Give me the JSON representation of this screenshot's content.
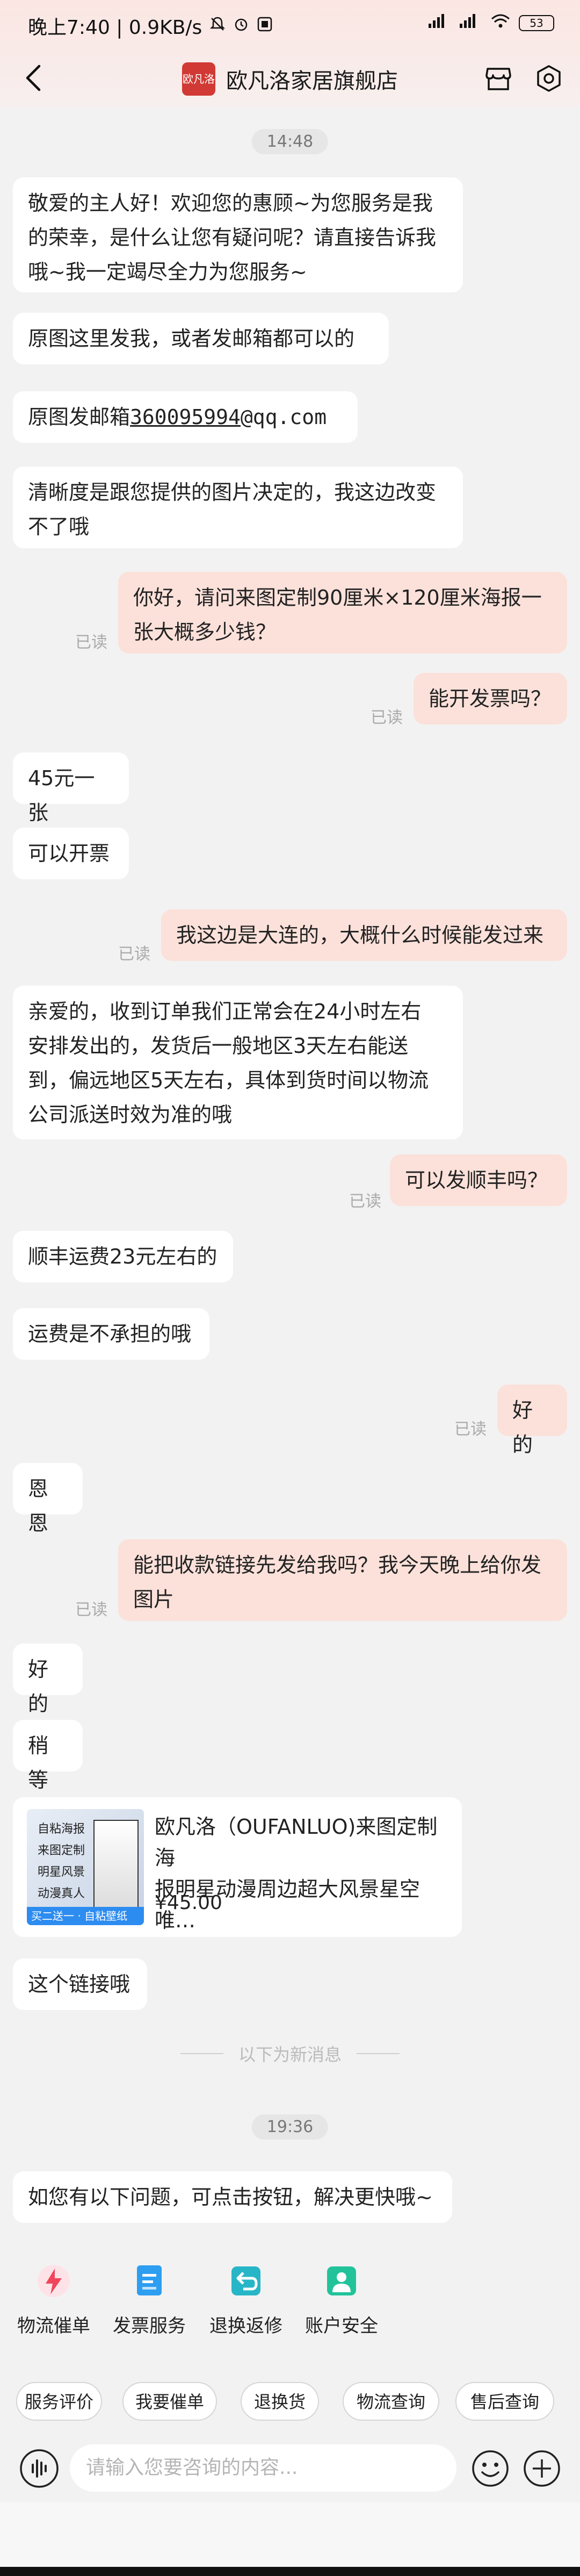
{
  "status": {
    "time_speed": "晚上7:40 | 0.9KB/s",
    "battery": "53"
  },
  "header": {
    "shop_name": "欧凡洛家居旗舰店",
    "logo_text": "欧凡洛"
  },
  "messages": {
    "t1": "14:48",
    "m1a": "敬爱的主人好！欢迎您的惠顾~为您服务是我",
    "m1b": "的荣幸，是什么让您有疑问呢？请直接告诉我",
    "m1c": "哦~我一定竭尽全力为您服务~",
    "m2": "原图这里发我，或者发邮箱都可以的",
    "m3_prefix": "原图发邮箱",
    "m3_link": "360095994",
    "m3_suffix": "@qq.com",
    "m4a": "清晰度是跟您提供的图片决定的，我这边改变",
    "m4b": "不了哦",
    "m5a": "你好，请问来图定制90厘米×120厘米海报一",
    "m5b": "张大概多少钱？",
    "m6": "能开发票吗？",
    "m7": "45元一张",
    "m8": "可以开票",
    "m9": "我这边是大连的，大概什么时候能发过来",
    "m10a": "亲爱的，收到订单我们正常会在24小时左右",
    "m10b": "安排发出的，发货后一般地区3天左右能送",
    "m10c": "到，偏远地区5天左右，具体到货时间以物流",
    "m10d": "公司派送时效为准的哦",
    "m11": "可以发顺丰吗？",
    "m12": "顺丰运费23元左右的",
    "m13": "运费是不承担的哦",
    "m14": "好的",
    "m15": "恩恩",
    "m16a": "能把收款链接先发给我吗？我今天晚上给你发",
    "m16b": "图片",
    "m17": "好的",
    "m18": "稍等",
    "m19": "这个链接哦",
    "divider": "以下为新消息",
    "t2": "19:36",
    "m20": "如您有以下问题，可点击按钮，解决更快哦~",
    "read": "已读"
  },
  "product": {
    "title_line1": "欧凡洛（OUFANLUO)来图定制海",
    "title_line2": "报明星动漫周边超大风景星空唯…",
    "price": "¥45.00",
    "thumb_lines": [
      "自粘海报",
      "来图定制",
      "明星风景",
      "动漫真人"
    ],
    "thumb_banner": "买二送一 · 自粘壁纸"
  },
  "quick_actions": [
    {
      "label": "物流催单",
      "icon": "lightning-icon"
    },
    {
      "label": "发票服务",
      "icon": "invoice-icon"
    },
    {
      "label": "退换返修",
      "icon": "return-icon"
    },
    {
      "label": "账户安全",
      "icon": "account-shield-icon"
    }
  ],
  "chips": [
    "服务评价",
    "我要催单",
    "退换货",
    "物流查询",
    "售后查询"
  ],
  "input": {
    "placeholder": "请输入您要咨询的内容..."
  },
  "colors": {
    "accent": "#d13a34",
    "outgoing_bubble": "#fbe1da",
    "incoming_bubble": "#ffffff",
    "icon_red": "#f0465c",
    "icon_blue": "#2d9ef0",
    "icon_teal": "#27b6c7"
  }
}
